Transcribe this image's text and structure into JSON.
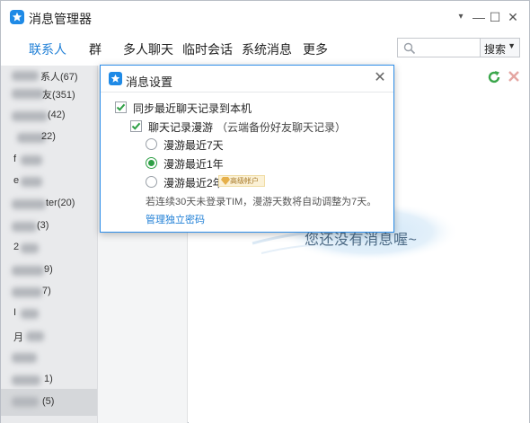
{
  "window": {
    "title": "消息管理器",
    "controls": {
      "menu": "▾",
      "minimize": "—",
      "maximize": "☐",
      "close": "✕"
    }
  },
  "tabs": [
    {
      "label": "联系人",
      "active": true
    },
    {
      "label": "群",
      "active": false
    },
    {
      "label": "多人聊天",
      "active": false
    },
    {
      "label": "临时会话",
      "active": false
    },
    {
      "label": "系统消息",
      "active": false
    },
    {
      "label": "更多",
      "active": false
    }
  ],
  "search": {
    "placeholder": "",
    "select_label": "搜索",
    "select_arrow": "▼"
  },
  "contacts": [
    {
      "label": "系人(67)"
    },
    {
      "label": "友(351)"
    },
    {
      "label": "(42)"
    },
    {
      "label": "22)"
    },
    {
      "label": "f"
    },
    {
      "label": "e"
    },
    {
      "label": "ter(20)"
    },
    {
      "label": "(3)"
    },
    {
      "label": "2"
    },
    {
      "label": "9)"
    },
    {
      "label": "7)"
    },
    {
      "label": "I"
    },
    {
      "label": "月"
    },
    {
      "label": ""
    },
    {
      "label": "1)"
    },
    {
      "label": "(5)",
      "selected": true
    }
  ],
  "content": {
    "empty_message": "您还没有消息喔~"
  },
  "icons": {
    "refresh": "refresh-icon",
    "delete": "delete-icon",
    "search": "search-icon",
    "logo": "star-logo-icon"
  },
  "colors": {
    "accent": "#1f7fd6",
    "check_green": "#2e9f45",
    "dialog_border": "#2d8de8"
  },
  "dialog": {
    "title": "消息设置",
    "close": "✕",
    "sync_local": {
      "label": "同步最近聊天记录到本机",
      "checked": true
    },
    "roaming": {
      "label": "聊天记录漫游",
      "note": "（云端备份好友聊天记录）",
      "checked": true
    },
    "options": [
      {
        "label": "漫游最近7天",
        "selected": false
      },
      {
        "label": "漫游最近1年",
        "selected": true
      },
      {
        "label": "漫游最近2年",
        "selected": false,
        "badge": "高级帐户"
      }
    ],
    "notice": "若连续30天未登录TIM，漫游天数将自动调整为7天。",
    "manage_link": "管理独立密码"
  }
}
